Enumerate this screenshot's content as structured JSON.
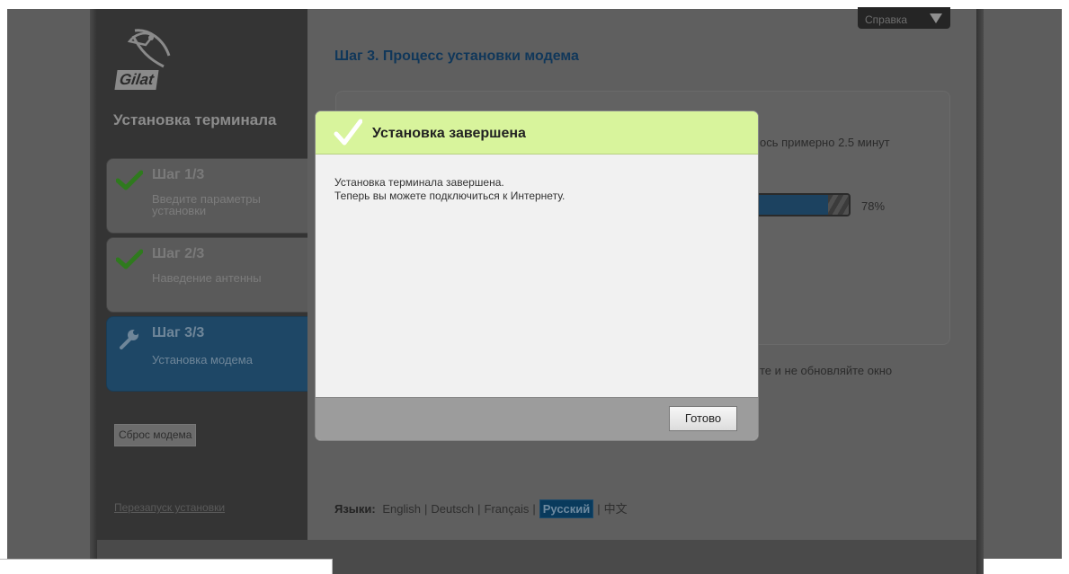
{
  "help": {
    "label": "Справка"
  },
  "sidebar": {
    "logo_text": "Gilat",
    "title": "Установка терминала",
    "steps": [
      {
        "title": "Шаг 1/3",
        "desc": "Введите параметры установки",
        "status": "done"
      },
      {
        "title": "Шаг 2/3",
        "desc": "Наведение антенны",
        "status": "done"
      },
      {
        "title": "Шаг 3/3",
        "desc": "Установка модема",
        "status": "active"
      }
    ],
    "reset_label": "Сброс модема",
    "restart_label": "Перезапуск установки"
  },
  "main": {
    "heading": "Шаг 3. Процесс установки модема",
    "time_left_text": "ось примерно 2.5 минут",
    "progress_percent": 78,
    "progress_label": "78%",
    "warning_text": "те и не обновляйте окно"
  },
  "languages": {
    "label": "Языки:",
    "items": [
      "English",
      "Deutsch",
      "Français",
      "Русский",
      "中文"
    ],
    "active": "Русский"
  },
  "modal": {
    "title": "Установка завершена",
    "line1": "Установка терминала завершена.",
    "line2": "Теперь вы можете подключиться к Интернету.",
    "done_label": "Готово"
  },
  "colors": {
    "modal_header": "#d8f49c",
    "active_step": "#1e4766",
    "heading": "#10375a",
    "check": "#2f8a1e"
  }
}
